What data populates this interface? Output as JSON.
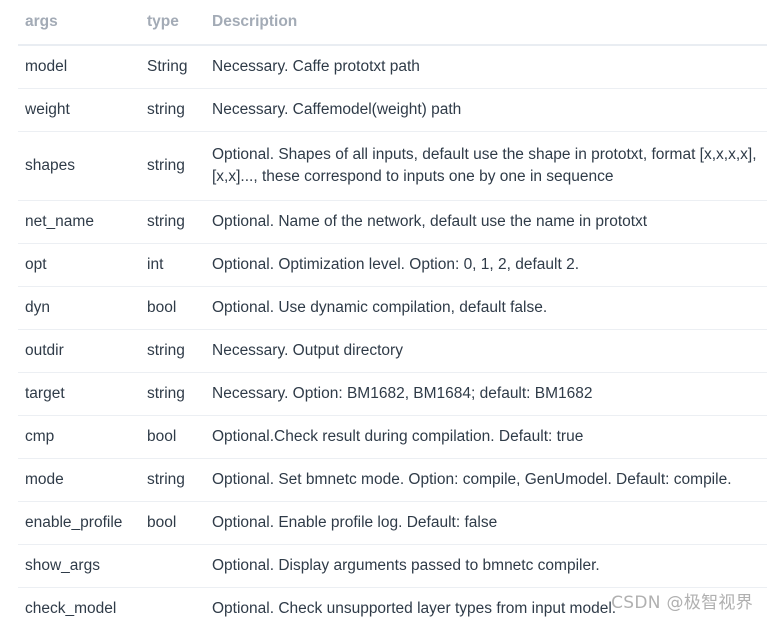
{
  "table": {
    "headers": {
      "args": "args",
      "type": "type",
      "description": "Description"
    },
    "rows": [
      {
        "args": "model",
        "type": "String",
        "description": "Necessary. Caffe prototxt path"
      },
      {
        "args": "weight",
        "type": "string",
        "description": "Necessary. Caffemodel(weight) path"
      },
      {
        "args": "shapes",
        "type": "string",
        "description": "Optional. Shapes of all inputs, default use the shape in prototxt, format [x,x,x,x], [x,x]..., these correspond to inputs one by one in sequence"
      },
      {
        "args": "net_name",
        "type": "string",
        "description": "Optional. Name of the network, default use the name in prototxt"
      },
      {
        "args": "opt",
        "type": "int",
        "description": "Optional. Optimization level. Option: 0, 1, 2, default 2."
      },
      {
        "args": "dyn",
        "type": "bool",
        "description": "Optional. Use dynamic compilation, default false."
      },
      {
        "args": "outdir",
        "type": "string",
        "description": "Necessary. Output directory"
      },
      {
        "args": "target",
        "type": "string",
        "description": "Necessary. Option: BM1682, BM1684; default: BM1682"
      },
      {
        "args": "cmp",
        "type": "bool",
        "description": "Optional.Check result during compilation. Default: true"
      },
      {
        "args": "mode",
        "type": "string",
        "description": "Optional. Set bmnetc mode. Option: compile, GenUmodel. Default: compile."
      },
      {
        "args": "enable_profile",
        "type": "bool",
        "description": "Optional. Enable profile log. Default: false"
      },
      {
        "args": "show_args",
        "type": "",
        "description": "Optional. Display arguments passed to bmnetc compiler."
      },
      {
        "args": "check_model",
        "type": "",
        "description": "Optional. Check unsupported layer types from input model."
      }
    ]
  },
  "watermark": "CSDN @极智视界"
}
